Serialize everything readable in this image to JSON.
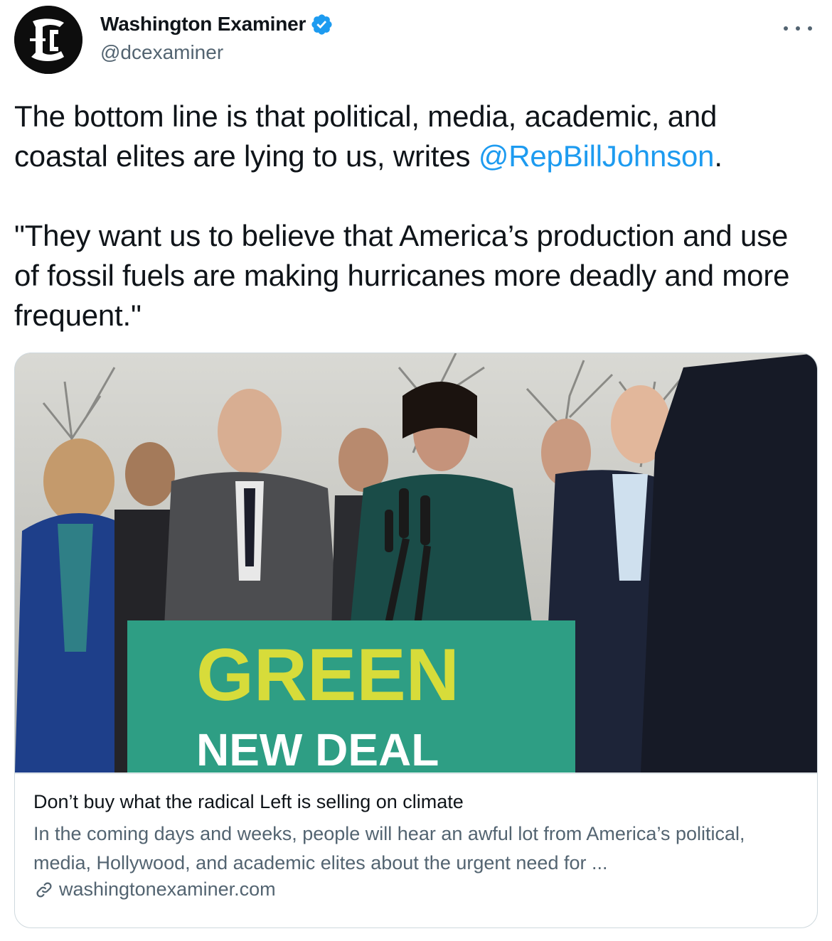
{
  "account": {
    "display_name": "Washington Examiner",
    "handle": "@dcexaminer",
    "verified": true,
    "avatar_icon": "washington-examiner-logo"
  },
  "tweet": {
    "line1_pre": "The bottom line is that political, media, academic, and coastal elites are lying to us, writes ",
    "mention": "@RepBillJohnson",
    "line1_post": ".",
    "quote": "\"They want us to believe that America’s production and use of fossil fuels are making hurricanes more deadly and more frequent.\""
  },
  "card": {
    "image_sign_line1": "GREEN",
    "image_sign_line2": "NEW DEAL",
    "title": "Don’t buy what the radical Left is selling on climate",
    "description": "In the coming days and weeks, people will hear an awful lot from America’s political, media, Hollywood, and academic elites about the urgent need for ...",
    "domain": "washingtonexaminer.com",
    "link_icon": "link-icon"
  },
  "colors": {
    "link": "#1d9bf0",
    "secondary_text": "#536471",
    "border": "#cfd9de",
    "verified_badge": "#1d9bf0",
    "sign_green": "#2e9e84",
    "sign_yellow": "#d7dc3a"
  }
}
